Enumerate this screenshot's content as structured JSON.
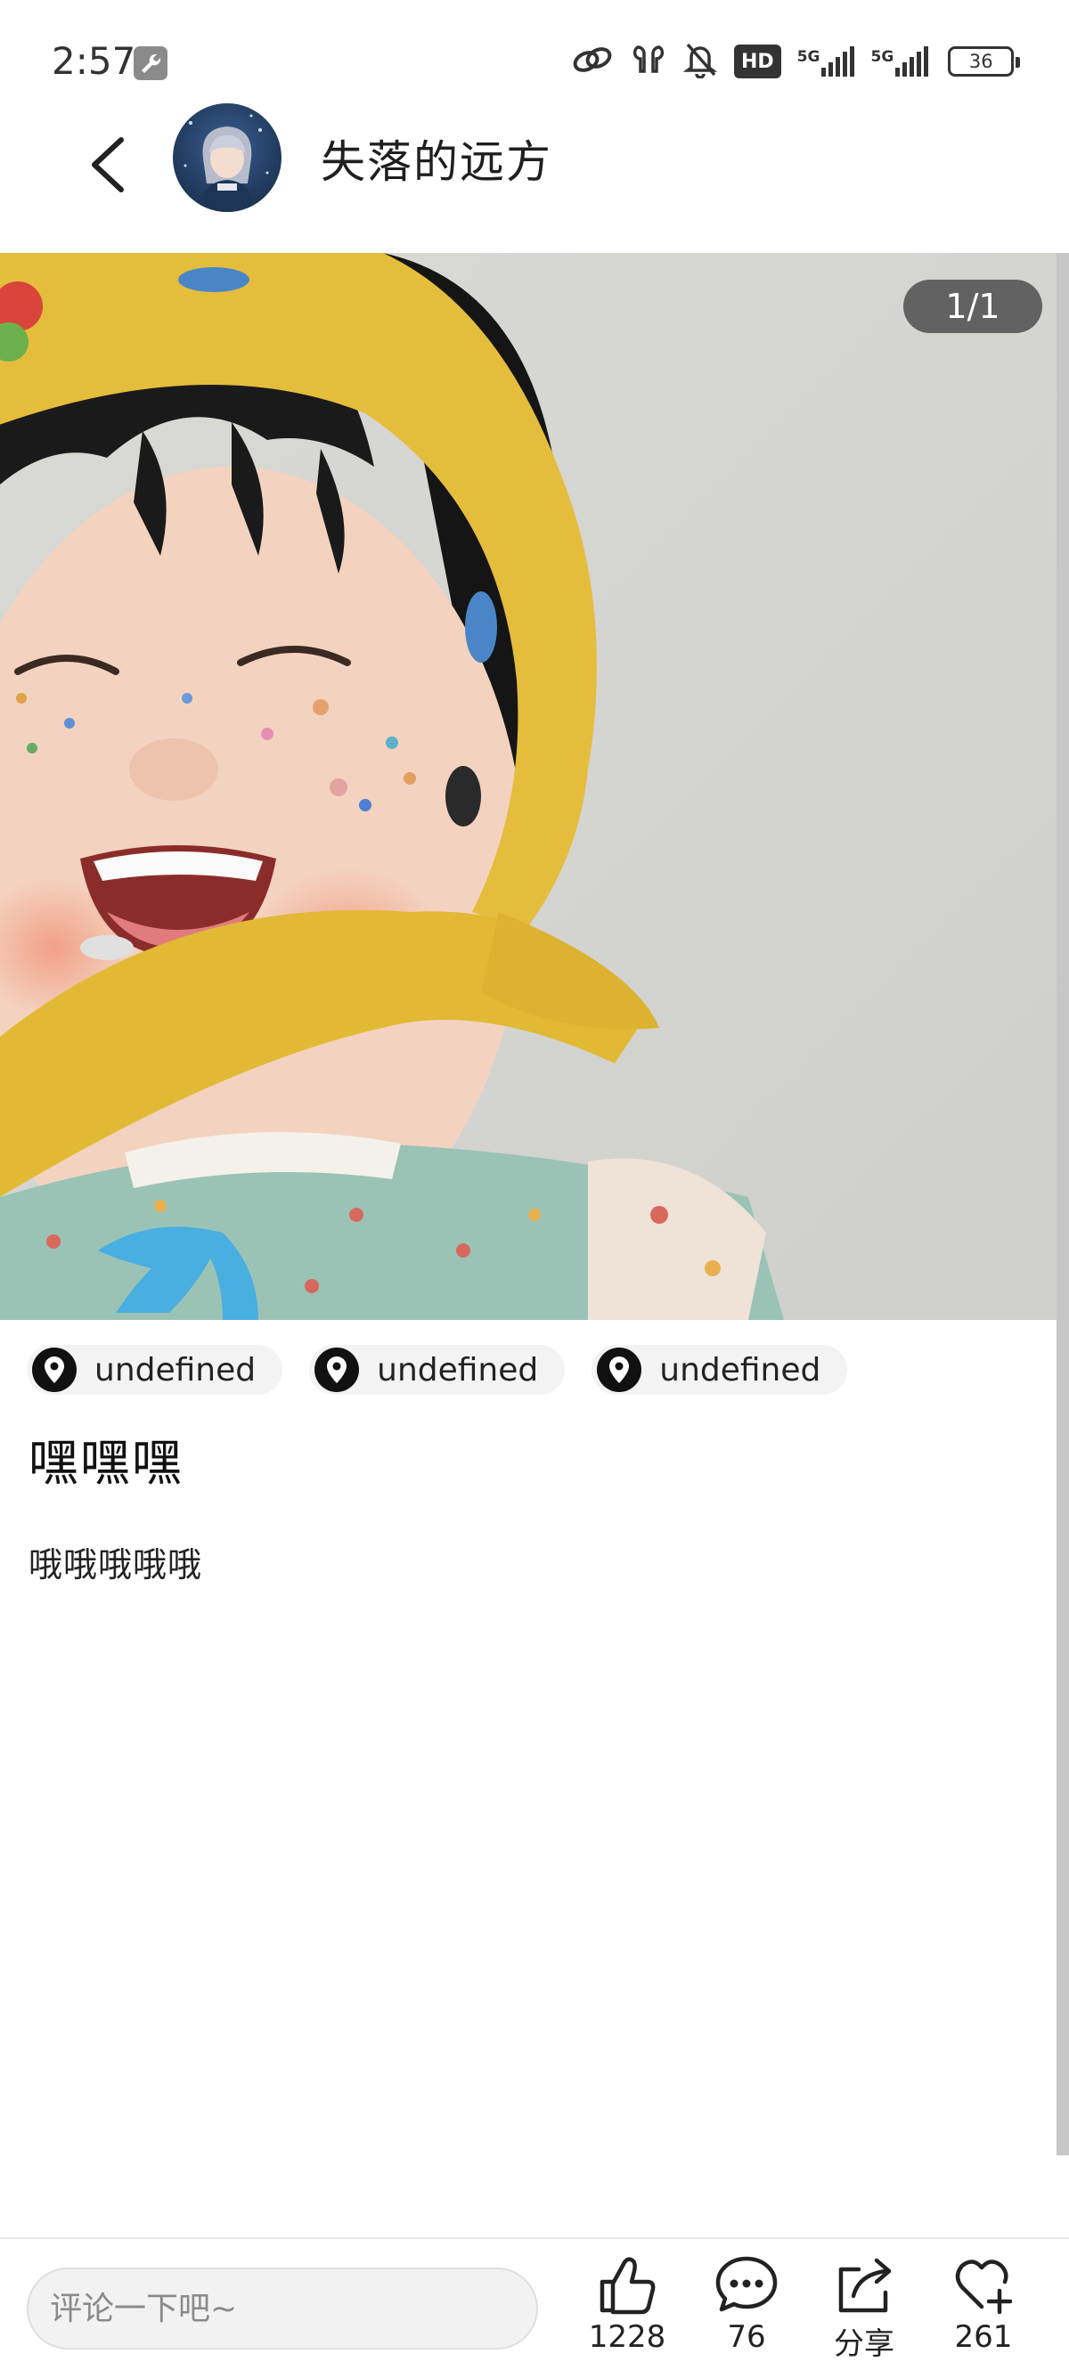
{
  "status_bar": {
    "time": "2:57",
    "network_1": "5G",
    "network_2": "5G",
    "battery": "36",
    "hd_label": "HD"
  },
  "header": {
    "title": "失落的远方"
  },
  "photo": {
    "page_indicator": "1/1"
  },
  "tags": [
    {
      "label": "undefined"
    },
    {
      "label": "undefined"
    },
    {
      "label": "undefined"
    }
  ],
  "post": {
    "title": "嘿嘿嘿",
    "body": "哦哦哦哦哦"
  },
  "bottom_bar": {
    "comment_placeholder": "评论一下吧~",
    "like_count": "1228",
    "comment_count": "76",
    "share_label": "分享",
    "favorite_count": "261"
  }
}
